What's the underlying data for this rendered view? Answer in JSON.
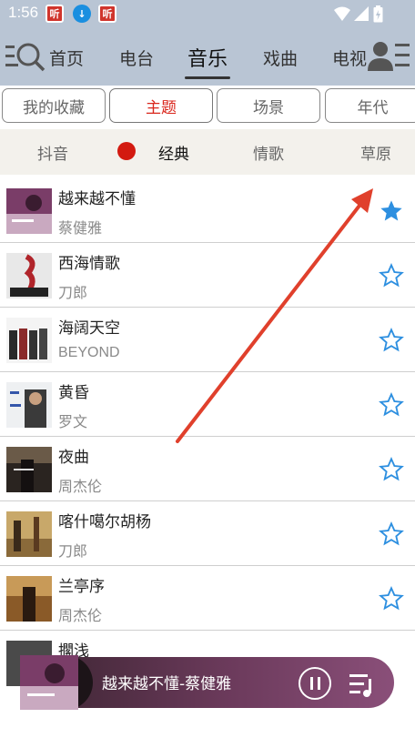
{
  "status_bar": {
    "time": "1:56",
    "notification_icons": [
      "red-app-icon",
      "download-icon",
      "red-app-icon"
    ],
    "system_icons": [
      "wifi-icon",
      "signal-icon",
      "battery-icon"
    ]
  },
  "top_nav": {
    "tabs": [
      {
        "label": "首页",
        "active": false
      },
      {
        "label": "电台",
        "active": false
      },
      {
        "label": "音乐",
        "active": true
      },
      {
        "label": "戏曲",
        "active": false
      },
      {
        "label": "电视",
        "active": false
      }
    ],
    "left_icon": "search-menu-icon",
    "right_icon": "user-menu-icon"
  },
  "sub_tabs": [
    {
      "label": "我的收藏",
      "active": false
    },
    {
      "label": "主题",
      "active": true
    },
    {
      "label": "场景",
      "active": false
    },
    {
      "label": "年代",
      "active": false
    }
  ],
  "categories": [
    {
      "label": "抖音",
      "active": false
    },
    {
      "label": "经典",
      "active": true
    },
    {
      "label": "情歌",
      "active": false
    },
    {
      "label": "草原",
      "active": false
    }
  ],
  "songs": [
    {
      "title": "越来越不懂",
      "artist": "蔡健雅",
      "favorited": true
    },
    {
      "title": "西海情歌",
      "artist": "刀郎",
      "favorited": false
    },
    {
      "title": "海阔天空",
      "artist": "BEYOND",
      "favorited": false
    },
    {
      "title": "黄昏",
      "artist": "罗文",
      "favorited": false
    },
    {
      "title": "夜曲",
      "artist": "周杰伦",
      "favorited": false
    },
    {
      "title": "喀什噶尔胡杨",
      "artist": "刀郎",
      "favorited": false
    },
    {
      "title": "兰亭序",
      "artist": "周杰伦",
      "favorited": false
    },
    {
      "title": "擱浅",
      "artist": "",
      "favorited": false
    }
  ],
  "player": {
    "now_playing": "越来越不懂-蔡健雅",
    "pause_icon": "pause-icon",
    "playlist_icon": "playlist-icon"
  },
  "colors": {
    "header_bg": "#b9c5d4",
    "accent_red": "#d9261c",
    "star_blue": "#2d8fe0",
    "annotation_arrow": "#e0402c"
  }
}
